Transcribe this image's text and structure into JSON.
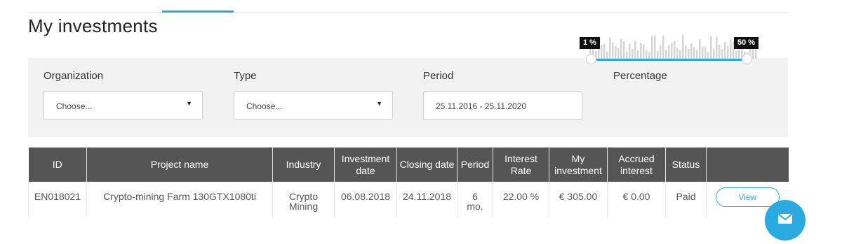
{
  "page": {
    "title": "My investments"
  },
  "filters": {
    "organization": {
      "label": "Organization",
      "value": "Choose..."
    },
    "type": {
      "label": "Type",
      "value": "Choose..."
    },
    "period": {
      "label": "Period",
      "value": "25.11.2016 - 25.11.2020"
    },
    "percentage": {
      "label": "Percentage",
      "min_label": "1 %",
      "max_label": "50 %",
      "min": 1,
      "max": 50
    }
  },
  "table": {
    "headers": [
      "ID",
      "Project name",
      "Industry",
      "Investment date",
      "Closing date",
      "Period",
      "Interest Rate",
      "My investment",
      "Accrued interest",
      "Status",
      ""
    ],
    "rows": [
      {
        "id": "EN018021",
        "project": "Crypto-mining Farm 130GTX1080ti",
        "industry": "Crypto Mining",
        "investment_date": "06.08.2018",
        "closing_date": "24.11.2018",
        "period": "6 mo.",
        "interest_rate": "22.00 %",
        "my_investment": "€ 305.00",
        "accrued_interest": "€ 0.00",
        "status": "Paid",
        "action": "View"
      }
    ]
  },
  "colors": {
    "accent": "#29abe2",
    "header_bg": "#555555",
    "filter_bg": "#f2f2f2"
  },
  "icons": {
    "select_arrow": "caret-down-icon",
    "chat": "chat-icon"
  }
}
